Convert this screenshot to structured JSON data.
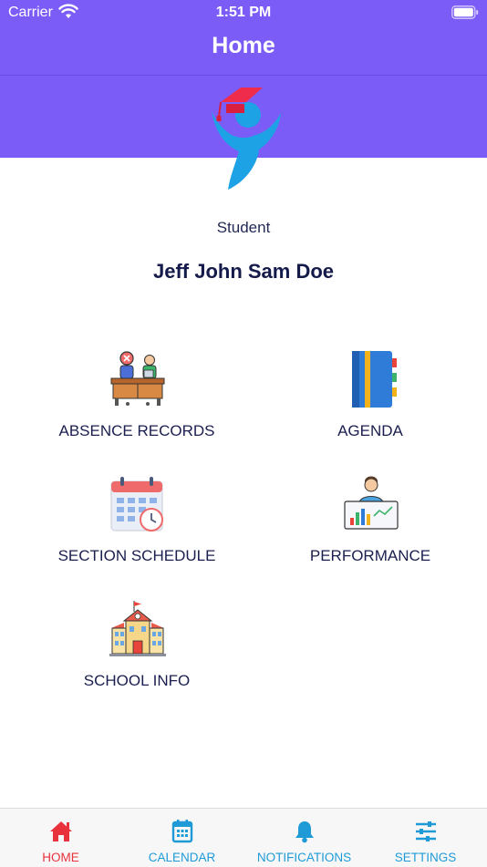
{
  "status_bar": {
    "carrier": "Carrier",
    "time": "1:51 PM"
  },
  "nav": {
    "title": "Home"
  },
  "profile": {
    "role": "Student",
    "name": "Jeff John Sam Doe"
  },
  "menu": [
    {
      "label": "ABSENCE RECORDS",
      "icon": "absence-desk-icon"
    },
    {
      "label": "AGENDA",
      "icon": "notebook-icon"
    },
    {
      "label": "SECTION SCHEDULE",
      "icon": "calendar-clock-icon"
    },
    {
      "label": "PERFORMANCE",
      "icon": "teacher-chart-icon"
    },
    {
      "label": "SCHOOL INFO",
      "icon": "school-building-icon"
    }
  ],
  "tabs": [
    {
      "label": "HOME",
      "icon": "home-icon",
      "active": true
    },
    {
      "label": "CALENDAR",
      "icon": "calendar-icon",
      "active": false
    },
    {
      "label": "NOTIFICATIONS",
      "icon": "bell-icon",
      "active": false
    },
    {
      "label": "SETTINGS",
      "icon": "sliders-icon",
      "active": false
    }
  ],
  "colors": {
    "header": "#7b5cf6",
    "tab_active": "#e8323c",
    "tab_inactive": "#1e9bd7",
    "text": "#1b1f4f"
  }
}
